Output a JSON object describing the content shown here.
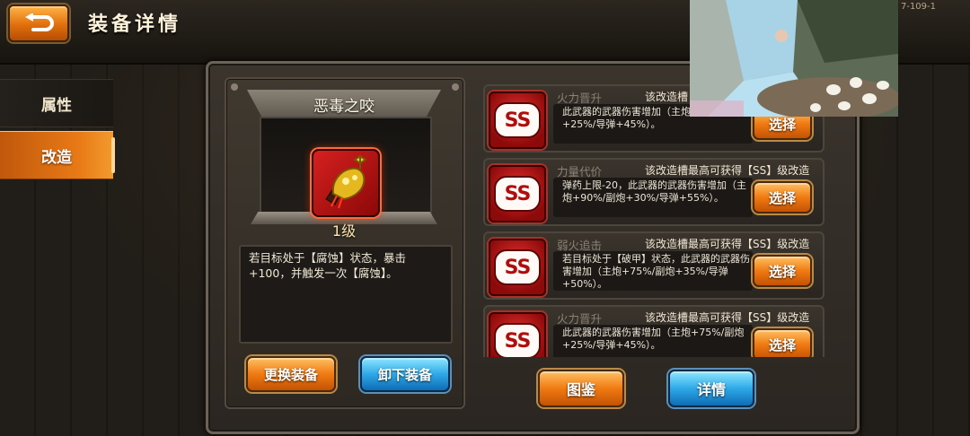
{
  "header": {
    "title": "装备详情",
    "version": "7-109-1"
  },
  "sidebar": {
    "tabs": [
      {
        "label": "属性"
      },
      {
        "label": "改造"
      }
    ]
  },
  "weapon": {
    "name": "恶毒之咬",
    "level": "1级",
    "description": "若目标处于【腐蚀】状态，暴击+100，并触发一次【腐蚀】。"
  },
  "left_buttons": {
    "replace": "更换装备",
    "unequip": "卸下装备"
  },
  "modifications": [
    {
      "grade": "SS",
      "name": "火力晋升",
      "hint": "该改造槽",
      "desc": "此武器的武器伤害增加（主炮+75%/副炮+25%/导弹+45%）。",
      "button": "选择"
    },
    {
      "grade": "SS",
      "name": "力量代价",
      "hint": "该改造槽最高可获得【SS】级改造",
      "desc": "弹药上限-20，此武器的武器伤害增加（主炮+90%/副炮+30%/导弹+55%）。",
      "button": "选择"
    },
    {
      "grade": "SS",
      "name": "弱火追击",
      "hint": "该改造槽最高可获得【SS】级改造",
      "desc": "若目标处于【破甲】状态，此武器的武器伤害增加（主炮+75%/副炮+35%/导弹+50%）。",
      "button": "选择"
    },
    {
      "grade": "SS",
      "name": "火力晋升",
      "hint": "该改造槽最高可获得【SS】级改造",
      "desc": "此武器的武器伤害增加（主炮+75%/副炮+25%/导弹+45%）。",
      "button": "选择"
    }
  ],
  "bottom_buttons": {
    "codex": "图鉴",
    "details": "详情"
  },
  "colors": {
    "accent_orange": "#f07a12",
    "accent_blue": "#2ea9e8",
    "grade_red": "#c41616"
  }
}
